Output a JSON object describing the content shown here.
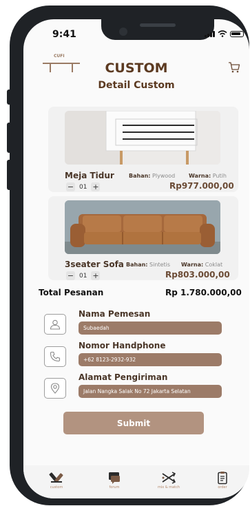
{
  "status_bar": {
    "time": "9:41"
  },
  "header": {
    "logo_text": "CUFI",
    "title": "CUSTOM",
    "subtitle": "Detail Custom",
    "cart_icon": "cart-icon"
  },
  "products": [
    {
      "name": "Meja Tidur",
      "material_label": "Bahan:",
      "material_value": "Plywood",
      "color_label": "Warna:",
      "color_value": "Putih",
      "qty_minus": "−",
      "qty": "01",
      "qty_plus": "+",
      "price": "Rp977.000,00"
    },
    {
      "name": "3seater Sofa",
      "material_label": "Bahan:",
      "material_value": "Sintetis",
      "color_label": "Warna:",
      "color_value": "Coklat",
      "qty_minus": "−",
      "qty": "01",
      "qty_plus": "+",
      "price": "Rp803.000,00"
    }
  ],
  "total": {
    "label": "Total Pesanan",
    "value": "Rp 1.780.000,00"
  },
  "form": {
    "name": {
      "label": "Nama Pemesan",
      "value": "Subaedah",
      "icon": "user-icon"
    },
    "phone": {
      "label": "Nomor Handphone",
      "value": "+62 8123-2932-932",
      "icon": "phone-icon"
    },
    "address": {
      "label": "Alamat Pengiriman",
      "value": "Jalan Nangka Salak No 72 Jakarta Selatan",
      "icon": "location-pin-icon"
    }
  },
  "submit_label": "Submit",
  "nav": [
    {
      "label": "custom",
      "icon": "custom-tools-icon"
    },
    {
      "label": "forum",
      "icon": "forum-chat-icon"
    },
    {
      "label": "mix & match",
      "icon": "mix-match-icon"
    },
    {
      "label": "order",
      "icon": "order-clipboard-icon"
    }
  ],
  "colors": {
    "brand_dark": "#5c3a21",
    "input_bg": "#9c7b68",
    "button_bg": "#b29380"
  }
}
